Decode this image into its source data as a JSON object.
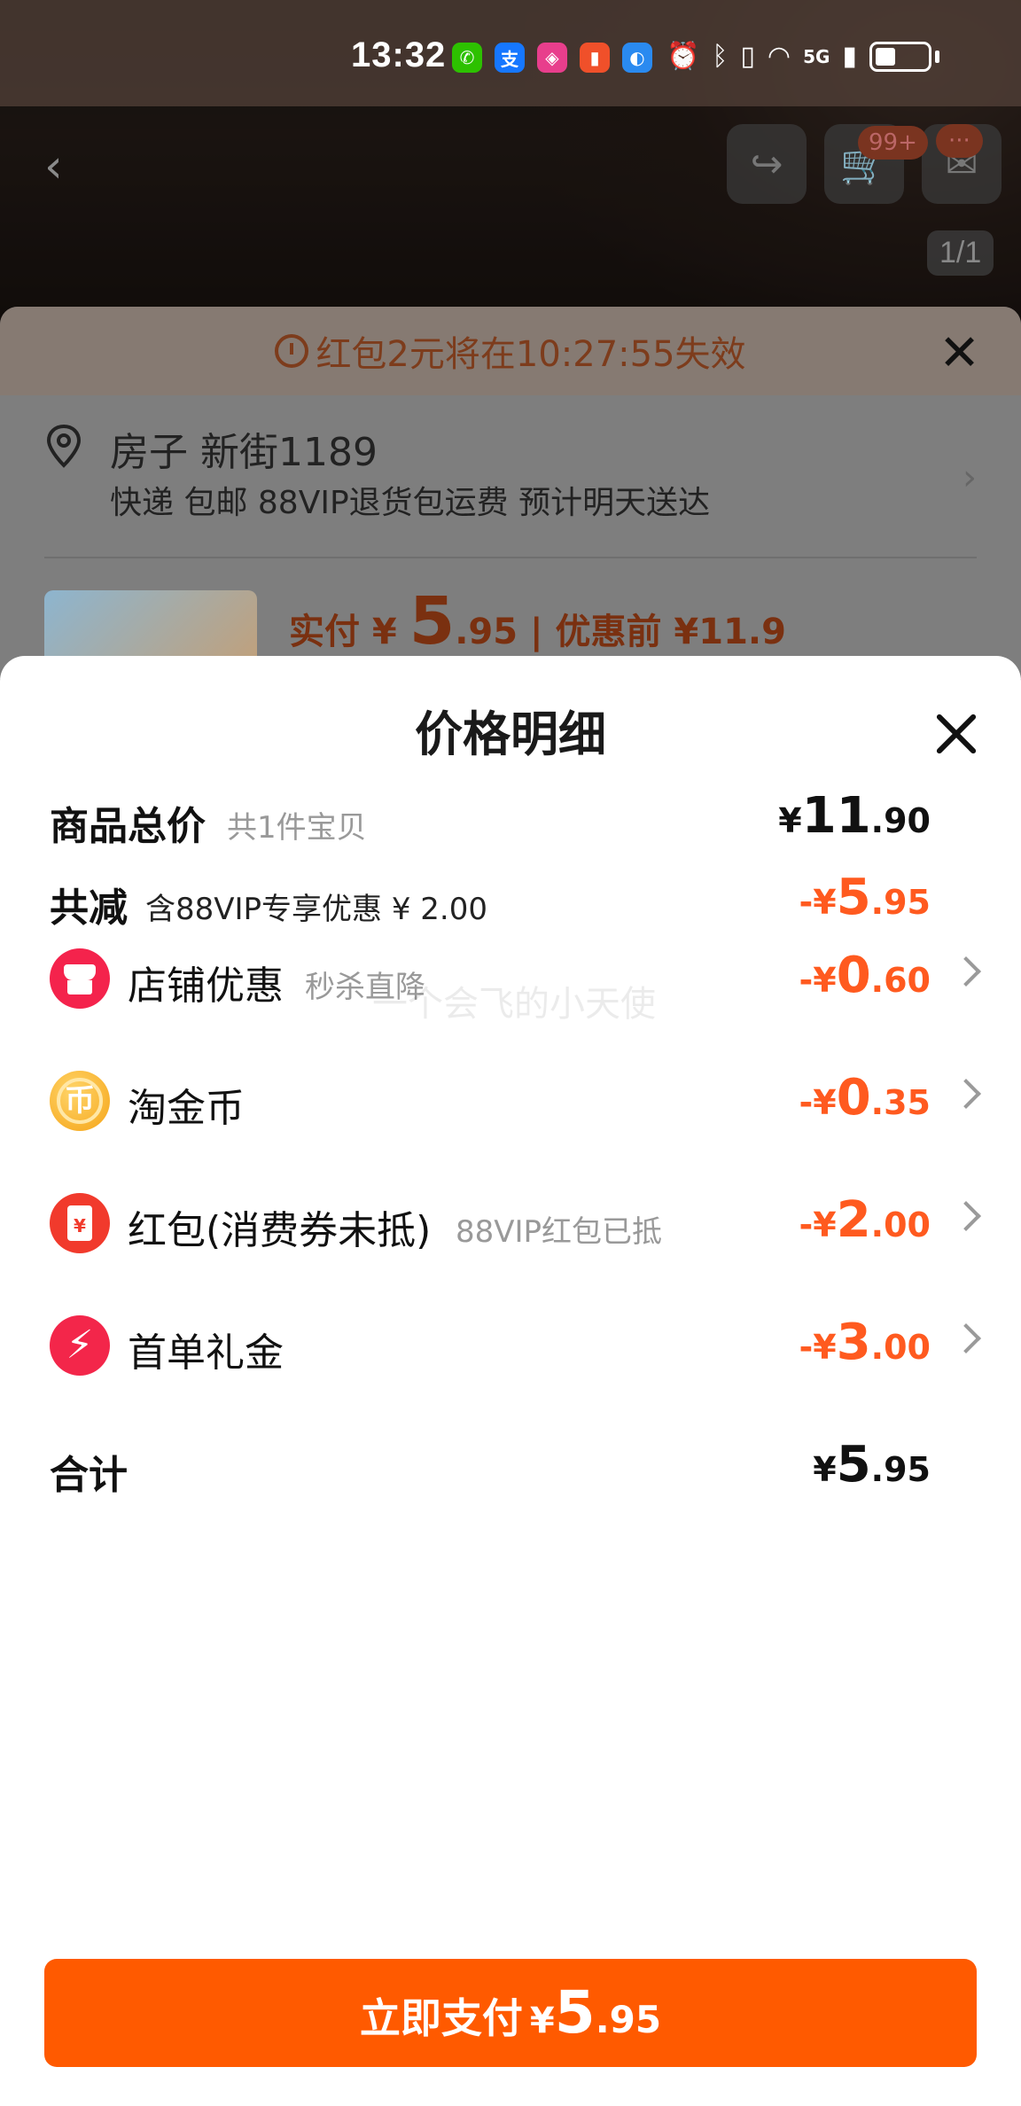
{
  "status_bar": {
    "time": "13:32",
    "apps": [
      {
        "name": "wechat",
        "glyph": "✆",
        "color": "#2dc100"
      },
      {
        "name": "alipay",
        "glyph": "支",
        "color": "#1677ff"
      },
      {
        "name": "app3",
        "glyph": "◈",
        "color": "#e83e8c"
      },
      {
        "name": "app4",
        "glyph": "▮",
        "color": "#f0502a"
      },
      {
        "name": "app5",
        "glyph": "◐",
        "color": "#2a8af0"
      }
    ],
    "network": "5G"
  },
  "product_page": {
    "cart_badge": "99+",
    "msg_badge": "···",
    "image_counter": "1/1"
  },
  "order": {
    "timer_text": "红包2元将在10:27:55失效",
    "address_name": "房子 新街1189",
    "address_sub": "快递 包邮 88VIP退货包运费 预计明天送达",
    "pay_prefix": "实付 ¥ ",
    "pay_int": "5",
    "pay_dec": ".95",
    "pay_before": " | 优惠前 ¥11.9"
  },
  "price_detail": {
    "title": "价格明细",
    "watermark": "一个会飞的小天使",
    "items_total": {
      "label": "商品总价",
      "sub": "共1件宝贝",
      "cur": "¥",
      "int": "11",
      "dec": ".90"
    },
    "total_discount": {
      "label": "共减",
      "sub": "含88VIP专享优惠 ¥ 2.00",
      "cur": "-¥",
      "int": "5",
      "dec": ".95"
    },
    "discounts": [
      {
        "label": "店铺优惠",
        "sub": "秒杀直降",
        "cur": "-¥",
        "int": "0",
        "dec": ".60",
        "icon": "shop-icon"
      },
      {
        "label": "淘金币",
        "sub": "",
        "cur": "-¥",
        "int": "0",
        "dec": ".35",
        "icon": "coin-icon",
        "icon_glyph": "币"
      },
      {
        "label": "红包(消费券未抵)",
        "sub": "88VIP红包已抵",
        "cur": "-¥",
        "int": "2",
        "dec": ".00",
        "icon": "red-envelope-icon",
        "icon_glyph": "¥"
      },
      {
        "label": "首单礼金",
        "sub": "",
        "cur": "-¥",
        "int": "3",
        "dec": ".00",
        "icon": "lightning-icon",
        "icon_glyph": "⚡"
      }
    ],
    "sum": {
      "label": "合计",
      "cur": "¥",
      "int": "5",
      "dec": ".95"
    }
  },
  "pay_button": {
    "label": "立即支付",
    "cur": "¥",
    "int": "5",
    "dec": ".95"
  },
  "colors": {
    "accent": "#ff5a00",
    "discount": "#ff5a1f"
  }
}
